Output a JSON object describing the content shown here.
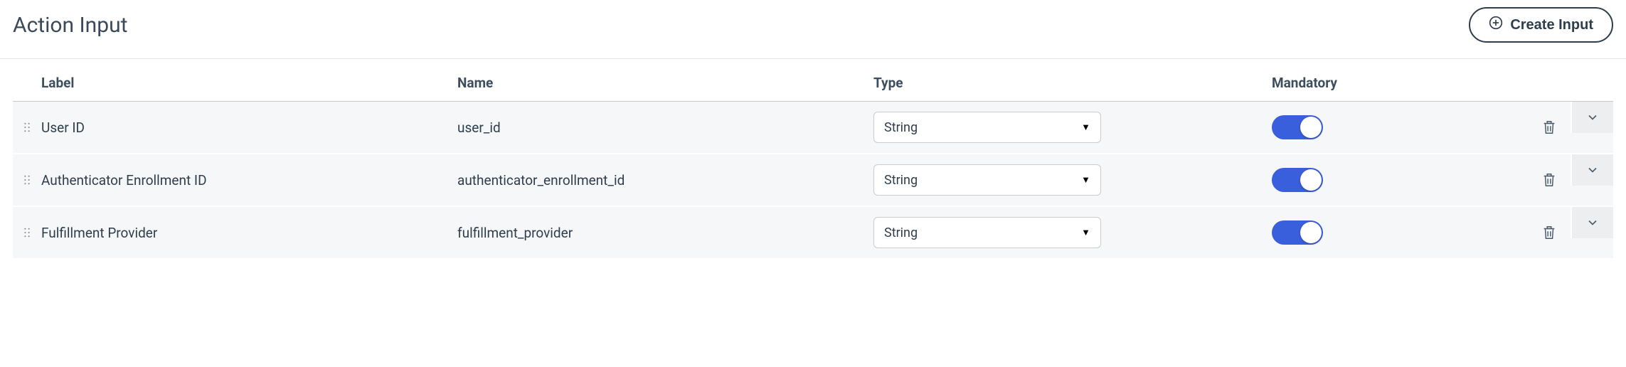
{
  "header": {
    "title": "Action Input",
    "create_label": "Create Input"
  },
  "columns": {
    "label": "Label",
    "name": "Name",
    "type": "Type",
    "mandatory": "Mandatory"
  },
  "rows": [
    {
      "label": "User ID",
      "name": "user_id",
      "type": "String",
      "mandatory": true
    },
    {
      "label": "Authenticator Enrollment ID",
      "name": "authenticator_enrollment_id",
      "type": "String",
      "mandatory": true
    },
    {
      "label": "Fulfillment Provider",
      "name": "fulfillment_provider",
      "type": "String",
      "mandatory": true
    }
  ]
}
